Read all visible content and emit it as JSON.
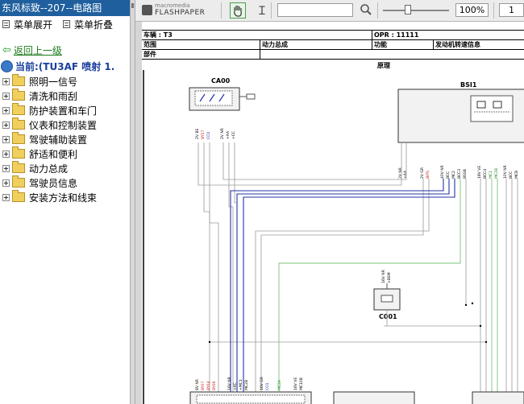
{
  "window": {
    "title": "东风标致--207--电路图"
  },
  "menu": {
    "expand_label": "菜单展开",
    "collapse_label": "菜单折叠"
  },
  "nav": {
    "up_label": "返回上一级",
    "current_label": "当前:(TU3AF 喷射  1."
  },
  "tree": {
    "items": [
      {
        "label": "照明一信号"
      },
      {
        "label": "清洗和雨刮"
      },
      {
        "label": "防护装置和车门"
      },
      {
        "label": "仪表和控制装置"
      },
      {
        "label": "驾驶辅助装置"
      },
      {
        "label": "舒适和便利"
      },
      {
        "label": "动力总成"
      },
      {
        "label": "驾驶员信息"
      },
      {
        "label": "安装方法和线束"
      }
    ]
  },
  "viewer": {
    "logo_line1": "macromedia",
    "logo_line2": "FLASHPAPER",
    "zoom": "100%",
    "page": "1",
    "search_value": ""
  },
  "sheet": {
    "vehicle": "车辆 : T3",
    "opr": "OPR : 11111",
    "domain_label": "范围",
    "domain_value": "动力总成",
    "function_label": "功能",
    "function_value": "发动机转速信息",
    "part_label": "部件",
    "section": "原理"
  },
  "schematic": {
    "component_ca00": "CA00",
    "component_bsi1": "BSI1",
    "component_c001": "C001",
    "ca00_pins": [
      "2V BE",
      "BY57",
      "CO1",
      "2V NR",
      "+AA",
      "+CC"
    ],
    "bsi_pins": [
      "2V NR",
      "+AA",
      "2V GR",
      "BIPS",
      "40V NR",
      "BCC",
      "MC2",
      "BCC3",
      "BSSB",
      "18V VE",
      "BCC4",
      "MC1",
      "MC2B",
      "10V NR",
      "BCC",
      "MCB"
    ],
    "c001_pins": [
      "16V NR",
      "+BSM"
    ],
    "bottom_pins": [
      "8V NR",
      "BY07",
      "BY04",
      "BY06",
      "16V NR",
      "+KC",
      "+MC1",
      "MC2B",
      "16V GR",
      "CO1",
      "MC2A",
      "16V VE",
      "MC10B"
    ],
    "colors": {
      "blue_wire": "#2233aa",
      "green_wire": "#7ac47a",
      "red_wire": "#c82020",
      "gray_wire": "#9a9a9a"
    }
  }
}
